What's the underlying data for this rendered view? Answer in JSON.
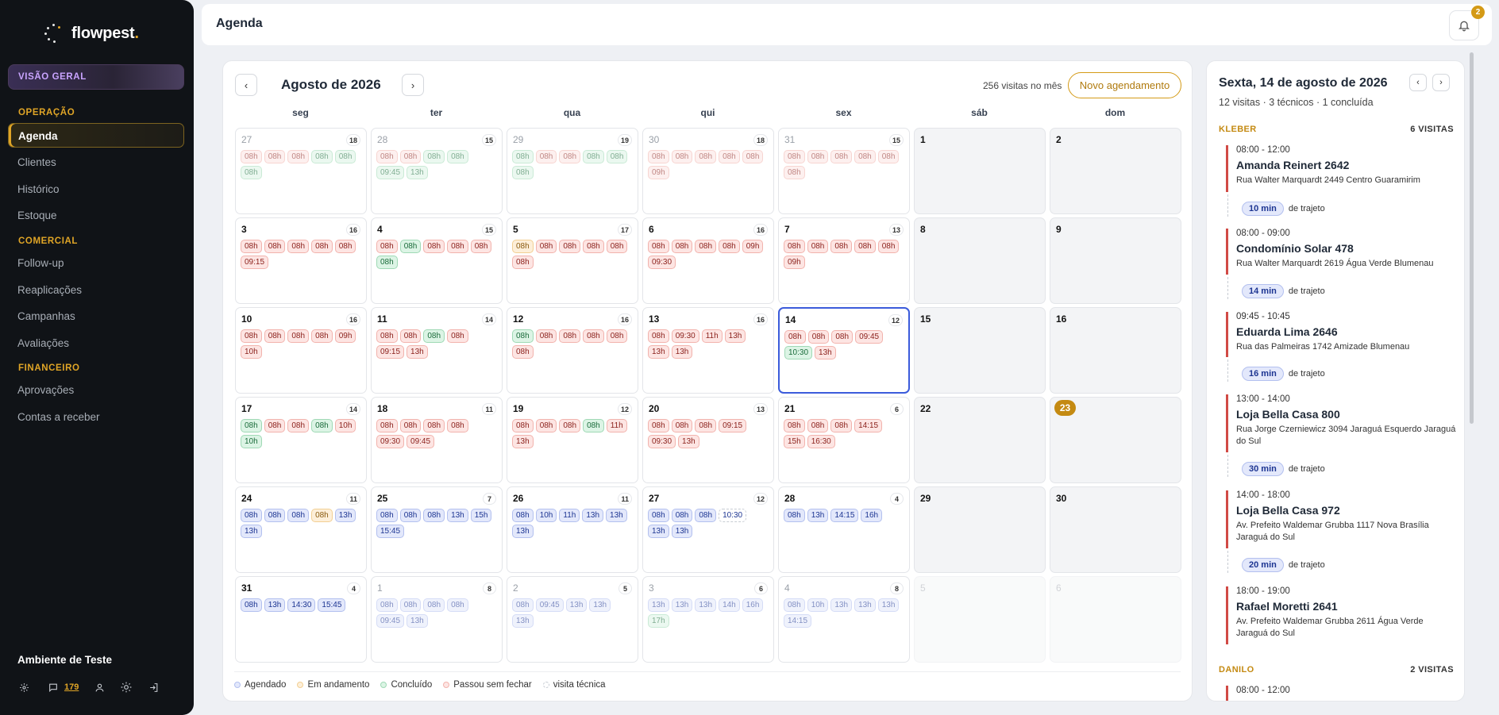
{
  "brand": {
    "name": "flowpest",
    "dot": "."
  },
  "sidebar": {
    "overview": "VISÃO GERAL",
    "sections": [
      {
        "title": "OPERAÇÃO",
        "items": [
          "Agenda",
          "Clientes",
          "Histórico",
          "Estoque"
        ]
      },
      {
        "title": "COMERCIAL",
        "items": [
          "Follow-up",
          "Reaplicações",
          "Campanhas",
          "Avaliações"
        ]
      },
      {
        "title": "FINANCEIRO",
        "items": [
          "Aprovações",
          "Contas a receber"
        ]
      }
    ],
    "active": "Agenda",
    "environment": "Ambiente de Teste",
    "messages_count": "179"
  },
  "header": {
    "title": "Agenda",
    "notifications": "2"
  },
  "calendar": {
    "month_label": "Agosto de 2026",
    "visits_month": "256 visitas no mês",
    "new_button": "Novo agendamento",
    "prev": "‹",
    "next": "›",
    "weekdays": [
      "seg",
      "ter",
      "qua",
      "qui",
      "sex",
      "sáb",
      "dom"
    ],
    "weeks": [
      [
        {
          "d": "27",
          "c": "18",
          "out": true,
          "chips": [
            [
              "08h",
              "r"
            ],
            [
              "08h",
              "r"
            ],
            [
              "08h",
              "r"
            ],
            [
              "08h",
              "g"
            ],
            [
              "08h",
              "g"
            ],
            [
              "08h",
              "g"
            ]
          ]
        },
        {
          "d": "28",
          "c": "15",
          "out": true,
          "chips": [
            [
              "08h",
              "r"
            ],
            [
              "08h",
              "r"
            ],
            [
              "08h",
              "g"
            ],
            [
              "08h",
              "g"
            ],
            [
              "09:45",
              "g"
            ],
            [
              "13h",
              "g"
            ]
          ]
        },
        {
          "d": "29",
          "c": "19",
          "out": true,
          "chips": [
            [
              "08h",
              "g"
            ],
            [
              "08h",
              "r"
            ],
            [
              "08h",
              "r"
            ],
            [
              "08h",
              "g"
            ],
            [
              "08h",
              "g"
            ],
            [
              "08h",
              "g"
            ]
          ]
        },
        {
          "d": "30",
          "c": "18",
          "out": true,
          "chips": [
            [
              "08h",
              "r"
            ],
            [
              "08h",
              "r"
            ],
            [
              "08h",
              "r"
            ],
            [
              "08h",
              "r"
            ],
            [
              "08h",
              "r"
            ],
            [
              "09h",
              "r"
            ]
          ]
        },
        {
          "d": "31",
          "c": "15",
          "out": true,
          "chips": [
            [
              "08h",
              "r"
            ],
            [
              "08h",
              "r"
            ],
            [
              "08h",
              "r"
            ],
            [
              "08h",
              "r"
            ],
            [
              "08h",
              "r"
            ],
            [
              "08h",
              "r"
            ]
          ]
        },
        {
          "d": "1",
          "c": "",
          "we": true,
          "chips": []
        },
        {
          "d": "2",
          "c": "",
          "we": true,
          "chips": []
        }
      ],
      [
        {
          "d": "3",
          "c": "16",
          "chips": [
            [
              "08h",
              "r"
            ],
            [
              "08h",
              "r"
            ],
            [
              "08h",
              "r"
            ],
            [
              "08h",
              "r"
            ],
            [
              "08h",
              "r"
            ],
            [
              "09:15",
              "r"
            ]
          ]
        },
        {
          "d": "4",
          "c": "15",
          "chips": [
            [
              "08h",
              "r"
            ],
            [
              "08h",
              "g"
            ],
            [
              "08h",
              "r"
            ],
            [
              "08h",
              "r"
            ],
            [
              "08h",
              "r"
            ],
            [
              "08h",
              "g"
            ]
          ]
        },
        {
          "d": "5",
          "c": "17",
          "chips": [
            [
              "08h",
              "o"
            ],
            [
              "08h",
              "r"
            ],
            [
              "08h",
              "r"
            ],
            [
              "08h",
              "r"
            ],
            [
              "08h",
              "r"
            ],
            [
              "08h",
              "r"
            ]
          ]
        },
        {
          "d": "6",
          "c": "16",
          "chips": [
            [
              "08h",
              "r"
            ],
            [
              "08h",
              "r"
            ],
            [
              "08h",
              "r"
            ],
            [
              "08h",
              "r"
            ],
            [
              "09h",
              "r"
            ],
            [
              "09:30",
              "r"
            ]
          ]
        },
        {
          "d": "7",
          "c": "13",
          "chips": [
            [
              "08h",
              "r"
            ],
            [
              "08h",
              "r"
            ],
            [
              "08h",
              "r"
            ],
            [
              "08h",
              "r"
            ],
            [
              "08h",
              "r"
            ],
            [
              "09h",
              "r"
            ]
          ]
        },
        {
          "d": "8",
          "c": "",
          "we": true,
          "chips": []
        },
        {
          "d": "9",
          "c": "",
          "we": true,
          "chips": []
        }
      ],
      [
        {
          "d": "10",
          "c": "16",
          "chips": [
            [
              "08h",
              "r"
            ],
            [
              "08h",
              "r"
            ],
            [
              "08h",
              "r"
            ],
            [
              "08h",
              "r"
            ],
            [
              "09h",
              "r"
            ],
            [
              "10h",
              "r"
            ]
          ]
        },
        {
          "d": "11",
          "c": "14",
          "chips": [
            [
              "08h",
              "r"
            ],
            [
              "08h",
              "r"
            ],
            [
              "08h",
              "g"
            ],
            [
              "08h",
              "r"
            ],
            [
              "09:15",
              "r"
            ],
            [
              "13h",
              "r"
            ]
          ]
        },
        {
          "d": "12",
          "c": "16",
          "chips": [
            [
              "08h",
              "g"
            ],
            [
              "08h",
              "r"
            ],
            [
              "08h",
              "r"
            ],
            [
              "08h",
              "r"
            ],
            [
              "08h",
              "r"
            ],
            [
              "08h",
              "r"
            ]
          ]
        },
        {
          "d": "13",
          "c": "16",
          "chips": [
            [
              "08h",
              "r"
            ],
            [
              "09:30",
              "r"
            ],
            [
              "11h",
              "r"
            ],
            [
              "13h",
              "r"
            ],
            [
              "13h",
              "r"
            ],
            [
              "13h",
              "r"
            ]
          ]
        },
        {
          "d": "14",
          "c": "12",
          "sel": true,
          "chips": [
            [
              "08h",
              "r"
            ],
            [
              "08h",
              "r"
            ],
            [
              "08h",
              "r"
            ],
            [
              "09:45",
              "r"
            ],
            [
              "10:30",
              "g"
            ],
            [
              "13h",
              "r"
            ]
          ]
        },
        {
          "d": "15",
          "c": "",
          "we": true,
          "chips": []
        },
        {
          "d": "16",
          "c": "",
          "we": true,
          "chips": []
        }
      ],
      [
        {
          "d": "17",
          "c": "14",
          "chips": [
            [
              "08h",
              "g"
            ],
            [
              "08h",
              "r"
            ],
            [
              "08h",
              "r"
            ],
            [
              "08h",
              "g"
            ],
            [
              "10h",
              "r"
            ],
            [
              "10h",
              "g"
            ]
          ]
        },
        {
          "d": "18",
          "c": "11",
          "chips": [
            [
              "08h",
              "r"
            ],
            [
              "08h",
              "r"
            ],
            [
              "08h",
              "r"
            ],
            [
              "08h",
              "r"
            ],
            [
              "09:30",
              "r"
            ],
            [
              "09:45",
              "r"
            ]
          ]
        },
        {
          "d": "19",
          "c": "12",
          "chips": [
            [
              "08h",
              "r"
            ],
            [
              "08h",
              "r"
            ],
            [
              "08h",
              "r"
            ],
            [
              "08h",
              "g"
            ],
            [
              "11h",
              "r"
            ],
            [
              "13h",
              "r"
            ]
          ]
        },
        {
          "d": "20",
          "c": "13",
          "chips": [
            [
              "08h",
              "r"
            ],
            [
              "08h",
              "r"
            ],
            [
              "08h",
              "r"
            ],
            [
              "09:15",
              "r"
            ],
            [
              "09:30",
              "r"
            ],
            [
              "13h",
              "r"
            ]
          ]
        },
        {
          "d": "21",
          "c": "6",
          "chips": [
            [
              "08h",
              "r"
            ],
            [
              "08h",
              "r"
            ],
            [
              "08h",
              "r"
            ],
            [
              "14:15",
              "r"
            ],
            [
              "15h",
              "r"
            ],
            [
              "16:30",
              "r"
            ]
          ]
        },
        {
          "d": "22",
          "c": "",
          "we": true,
          "chips": []
        },
        {
          "d": "23",
          "c": "",
          "we": true,
          "today": true,
          "chips": []
        }
      ],
      [
        {
          "d": "24",
          "c": "11",
          "chips": [
            [
              "08h",
              "b"
            ],
            [
              "08h",
              "b"
            ],
            [
              "08h",
              "b"
            ],
            [
              "08h",
              "o"
            ],
            [
              "13h",
              "b"
            ],
            [
              "13h",
              "b"
            ]
          ]
        },
        {
          "d": "25",
          "c": "7",
          "chips": [
            [
              "08h",
              "b"
            ],
            [
              "08h",
              "b"
            ],
            [
              "08h",
              "b"
            ],
            [
              "13h",
              "b"
            ],
            [
              "15h",
              "b"
            ],
            [
              "15:45",
              "b"
            ]
          ]
        },
        {
          "d": "26",
          "c": "11",
          "chips": [
            [
              "08h",
              "b"
            ],
            [
              "10h",
              "b"
            ],
            [
              "11h",
              "b"
            ],
            [
              "13h",
              "b"
            ],
            [
              "13h",
              "b"
            ],
            [
              "13h",
              "b"
            ]
          ]
        },
        {
          "d": "27",
          "c": "12",
          "chips": [
            [
              "08h",
              "b"
            ],
            [
              "08h",
              "b"
            ],
            [
              "08h",
              "b"
            ],
            [
              "10:30",
              "w"
            ],
            [
              "13h",
              "b"
            ],
            [
              "13h",
              "b"
            ]
          ]
        },
        {
          "d": "28",
          "c": "4",
          "chips": [
            [
              "08h",
              "b"
            ],
            [
              "13h",
              "b"
            ],
            [
              "14:15",
              "b"
            ],
            [
              "16h",
              "b"
            ]
          ]
        },
        {
          "d": "29",
          "c": "",
          "we": true,
          "chips": []
        },
        {
          "d": "30",
          "c": "",
          "we": true,
          "chips": []
        }
      ],
      [
        {
          "d": "31",
          "c": "4",
          "chips": [
            [
              "08h",
              "b"
            ],
            [
              "13h",
              "b"
            ],
            [
              "14:30",
              "b"
            ],
            [
              "15:45",
              "b"
            ]
          ]
        },
        {
          "d": "1",
          "c": "8",
          "out": true,
          "chips": [
            [
              "08h",
              "b"
            ],
            [
              "08h",
              "b"
            ],
            [
              "08h",
              "b"
            ],
            [
              "08h",
              "b"
            ],
            [
              "09:45",
              "b"
            ],
            [
              "13h",
              "b"
            ]
          ]
        },
        {
          "d": "2",
          "c": "5",
          "out": true,
          "chips": [
            [
              "08h",
              "b"
            ],
            [
              "09:45",
              "b"
            ],
            [
              "13h",
              "b"
            ],
            [
              "13h",
              "b"
            ],
            [
              "13h",
              "b"
            ]
          ]
        },
        {
          "d": "3",
          "c": "6",
          "out": true,
          "chips": [
            [
              "13h",
              "b"
            ],
            [
              "13h",
              "b"
            ],
            [
              "13h",
              "b"
            ],
            [
              "14h",
              "b"
            ],
            [
              "16h",
              "b"
            ],
            [
              "17h",
              "g"
            ]
          ]
        },
        {
          "d": "4",
          "c": "8",
          "out": true,
          "chips": [
            [
              "08h",
              "b"
            ],
            [
              "10h",
              "b"
            ],
            [
              "13h",
              "b"
            ],
            [
              "13h",
              "b"
            ],
            [
              "13h",
              "b"
            ],
            [
              "14:15",
              "b"
            ]
          ]
        },
        {
          "d": "5",
          "c": "",
          "we": true,
          "out": true,
          "chips": []
        },
        {
          "d": "6",
          "c": "",
          "we": true,
          "out": true,
          "chips": []
        }
      ]
    ],
    "legend": [
      "Agendado",
      "Em andamento",
      "Concluído",
      "Passou sem fechar",
      "visita técnica"
    ]
  },
  "colors": {
    "red": "#d14a45",
    "green": "#2f9e5a",
    "blue": "#3b5bdb",
    "orange": "#d49a16",
    "accent": "#e0a526"
  },
  "panel": {
    "date": "Sexta, 14 de agosto de 2026",
    "summary": "12 visitas · 3 técnicos · 1 concluída",
    "technicians": [
      {
        "name": "KLEBER",
        "visits": "6 VISITAS"
      },
      {
        "name": "DANILO",
        "visits": "2 VISITAS"
      }
    ],
    "visits": [
      {
        "time": "08:00 - 12:00",
        "name": "Amanda Reinert 2642",
        "addr": "Rua Walter Marquardt 2449 Centro Guaramirim"
      },
      {
        "time": "08:00 - 09:00",
        "name": "Condomínio Solar 478",
        "addr": "Rua Walter Marquardt 2619 Água Verde Blumenau"
      },
      {
        "time": "09:45 - 10:45",
        "name": "Eduarda Lima 2646",
        "addr": "Rua das Palmeiras 1742 Amizade Blumenau"
      },
      {
        "time": "13:00 - 14:00",
        "name": "Loja Bella Casa 800",
        "addr": "Rua Jorge Czerniewicz 3094 Jaraguá Esquerdo Jaraguá do Sul"
      },
      {
        "time": "14:00 - 18:00",
        "name": "Loja Bella Casa 972",
        "addr": "Av. Prefeito Waldemar Grubba 1117 Nova Brasília Jaraguá do Sul"
      },
      {
        "time": "18:00 - 19:00",
        "name": "Rafael Moretti 2641",
        "addr": "Av. Prefeito Waldemar Grubba 2611 Água Verde Jaraguá do Sul"
      },
      {
        "time": "08:00 - 12:00"
      }
    ],
    "trips": [
      "10 min",
      "14 min",
      "16 min",
      "30 min",
      "20 min"
    ],
    "trip_label": "de trajeto"
  }
}
